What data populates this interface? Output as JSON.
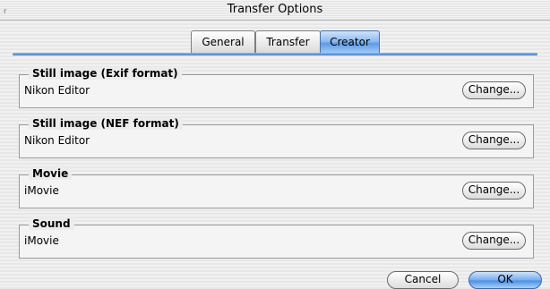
{
  "window": {
    "title": "Transfer Options",
    "corner_mark": "r"
  },
  "tabs": [
    {
      "label": "General",
      "selected": false
    },
    {
      "label": "Transfer",
      "selected": false
    },
    {
      "label": "Creator",
      "selected": true
    }
  ],
  "groups": [
    {
      "legend": "Still image (Exif format)",
      "app": "Nikon Editor",
      "button": "Change..."
    },
    {
      "legend": "Still image (NEF format)",
      "app": "Nikon Editor",
      "button": "Change..."
    },
    {
      "legend": "Movie",
      "app": "iMovie",
      "button": "Change..."
    },
    {
      "legend": "Sound",
      "app": "iMovie",
      "button": "Change..."
    }
  ],
  "footer": {
    "cancel_label": "Cancel",
    "ok_label": "OK"
  },
  "colors": {
    "accent": "#5d9be8",
    "tab_line": "#3f7fd1"
  }
}
